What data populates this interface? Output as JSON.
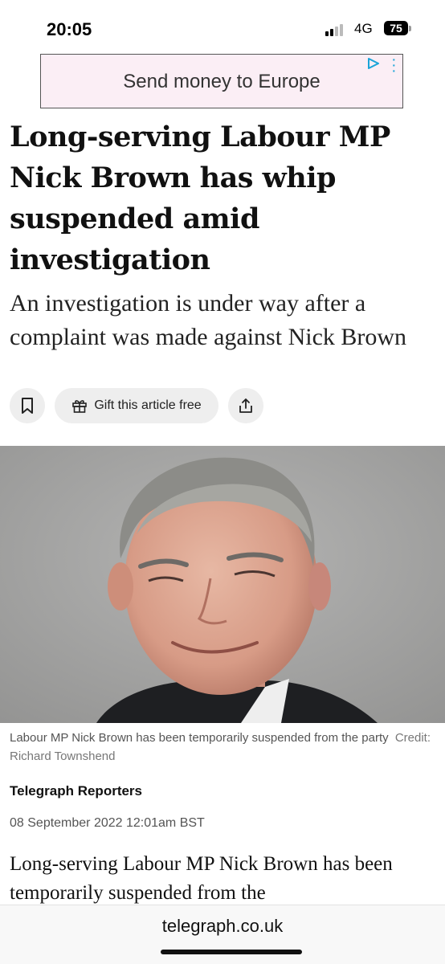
{
  "status_bar": {
    "time": "20:05",
    "network": "4G",
    "battery": "75"
  },
  "ad": {
    "text": "Send money to Europe",
    "play_icon": "ad-choices-icon",
    "menu_icon": "more-vert-icon"
  },
  "article": {
    "headline": "Long-serving Labour MP Nick Brown has whip suspended amid investigation",
    "standfirst": "An investigation is under way after a complaint was made against Nick Brown",
    "actions": {
      "bookmark_icon": "bookmark-icon",
      "gift_label": "Gift this article free",
      "gift_icon": "gift-icon",
      "share_icon": "share-icon"
    },
    "caption": "Labour MP Nick Brown has been temporarily suspended from the party",
    "credit": "Credit: Richard Townshend",
    "byline": "Telegraph Reporters",
    "date": "08 September 2022 12:01am BST",
    "body": "Long-serving Labour MP Nick Brown has been temporarily suspended from the"
  },
  "browser": {
    "url": "telegraph.co.uk"
  },
  "colors": {
    "accent_ad": "#1aa4d8",
    "ad_background": "#fbeef5",
    "button_background": "#eeeeee"
  }
}
